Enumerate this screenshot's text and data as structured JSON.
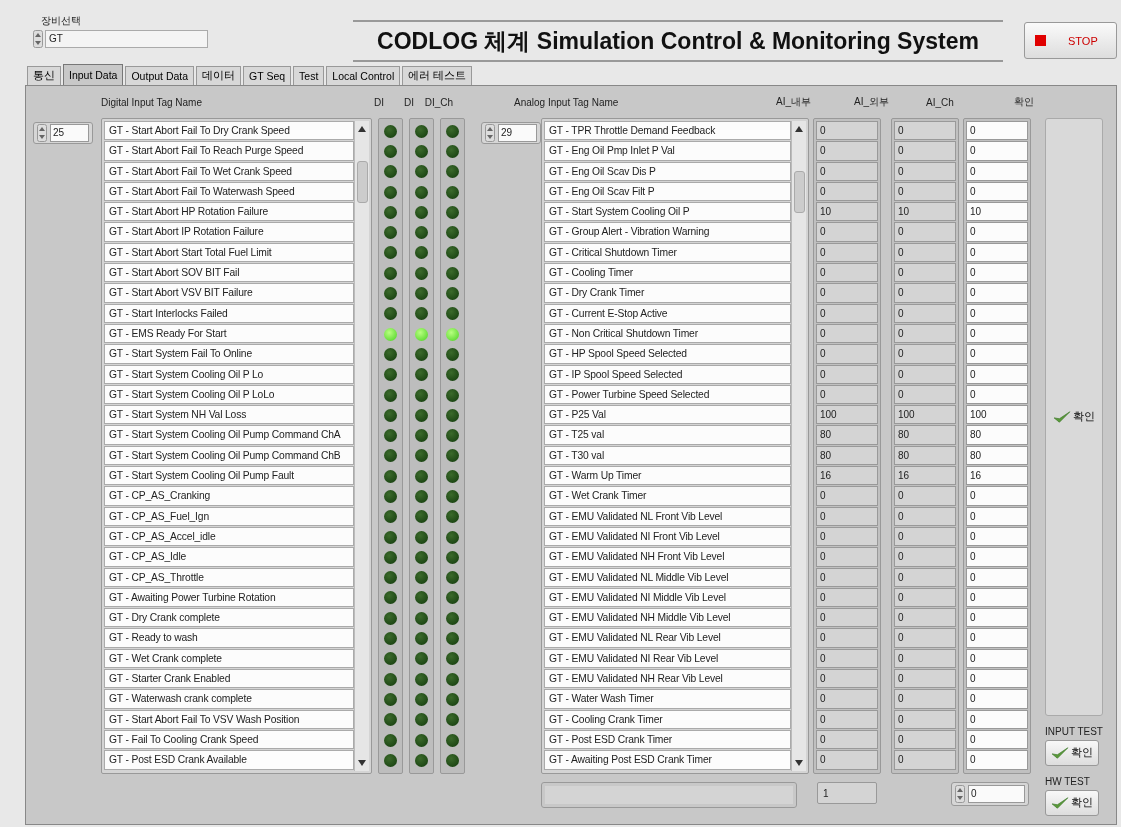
{
  "device_select": {
    "label": "장비선택",
    "value": "GT"
  },
  "title": "CODLOG 체계 Simulation Control & Monitoring System",
  "stop_button": {
    "label": "STOP"
  },
  "tabs": [
    {
      "label": "통신",
      "selected": false
    },
    {
      "label": "Input Data",
      "selected": true
    },
    {
      "label": "Output Data",
      "selected": false
    },
    {
      "label": "데이터",
      "selected": false
    },
    {
      "label": "GT Seq",
      "selected": false
    },
    {
      "label": "Test",
      "selected": false
    },
    {
      "label": "Local Control",
      "selected": false
    },
    {
      "label": "에러 테스트",
      "selected": false
    }
  ],
  "digital": {
    "header": "Digital Input Tag Name",
    "column_headers": [
      "DI",
      "DI",
      "DI_Ch"
    ],
    "index": "25",
    "rows": [
      {
        "name": "GT - Start Abort Fail To Dry Crank Speed",
        "leds": [
          false,
          false,
          false
        ]
      },
      {
        "name": "GT - Start Abort Fail To Reach Purge Speed",
        "leds": [
          false,
          false,
          false
        ]
      },
      {
        "name": "GT - Start Abort Fail To Wet Crank Speed",
        "leds": [
          false,
          false,
          false
        ]
      },
      {
        "name": "GT - Start Abort Fail To Waterwash Speed",
        "leds": [
          false,
          false,
          false
        ]
      },
      {
        "name": "GT - Start Abort HP Rotation Failure",
        "leds": [
          false,
          false,
          false
        ]
      },
      {
        "name": "GT - Start Abort IP Rotation Failure",
        "leds": [
          false,
          false,
          false
        ]
      },
      {
        "name": "GT - Start Abort Start Total Fuel Limit",
        "leds": [
          false,
          false,
          false
        ]
      },
      {
        "name": "GT - Start Abort SOV BIT Fail",
        "leds": [
          false,
          false,
          false
        ]
      },
      {
        "name": "GT - Start Abort VSV BIT Failure",
        "leds": [
          false,
          false,
          false
        ]
      },
      {
        "name": "GT - Start Interlocks Failed",
        "leds": [
          false,
          false,
          false
        ]
      },
      {
        "name": "GT - EMS Ready For Start",
        "leds": [
          true,
          true,
          true
        ]
      },
      {
        "name": "GT - Start System Fail To Online",
        "leds": [
          false,
          false,
          false
        ]
      },
      {
        "name": "GT - Start System Cooling Oil P Lo",
        "leds": [
          false,
          false,
          false
        ]
      },
      {
        "name": "GT - Start System Cooling Oil P LoLo",
        "leds": [
          false,
          false,
          false
        ]
      },
      {
        "name": "GT - Start System NH Val Loss",
        "leds": [
          false,
          false,
          false
        ]
      },
      {
        "name": "GT - Start System Cooling Oil Pump Command ChA",
        "leds": [
          false,
          false,
          false
        ]
      },
      {
        "name": "GT - Start System Cooling Oil Pump Command ChB",
        "leds": [
          false,
          false,
          false
        ]
      },
      {
        "name": "GT - Start System Cooling Oil Pump Fault",
        "leds": [
          false,
          false,
          false
        ]
      },
      {
        "name": "GT - CP_AS_Cranking",
        "leds": [
          false,
          false,
          false
        ]
      },
      {
        "name": "GT - CP_AS_Fuel_Ign",
        "leds": [
          false,
          false,
          false
        ]
      },
      {
        "name": "GT - CP_AS_Accel_idle",
        "leds": [
          false,
          false,
          false
        ]
      },
      {
        "name": "GT - CP_AS_Idle",
        "leds": [
          false,
          false,
          false
        ]
      },
      {
        "name": "GT - CP_AS_Throttle",
        "leds": [
          false,
          false,
          false
        ]
      },
      {
        "name": "GT - Awaiting Power Turbine Rotation",
        "leds": [
          false,
          false,
          false
        ]
      },
      {
        "name": "GT - Dry Crank complete",
        "leds": [
          false,
          false,
          false
        ]
      },
      {
        "name": "GT - Ready to wash",
        "leds": [
          false,
          false,
          false
        ]
      },
      {
        "name": "GT - Wet Crank complete",
        "leds": [
          false,
          false,
          false
        ]
      },
      {
        "name": "GT - Starter Crank Enabled",
        "leds": [
          false,
          false,
          false
        ]
      },
      {
        "name": "GT - Waterwash crank complete",
        "leds": [
          false,
          false,
          false
        ]
      },
      {
        "name": "GT - Start Abort Fail To VSV Wash Position",
        "leds": [
          false,
          false,
          false
        ]
      },
      {
        "name": "GT - Fail To Cooling Crank Speed",
        "leds": [
          false,
          false,
          false
        ]
      },
      {
        "name": "GT - Post ESD Crank Available",
        "leds": [
          false,
          false,
          false
        ]
      }
    ]
  },
  "analog": {
    "header": "Analog Input Tag Name",
    "column_headers": [
      "AI_내부",
      "AI_외부",
      "AI_Ch"
    ],
    "index": "29",
    "rows": [
      {
        "name": "GT - TPR Throttle Demand Feedback",
        "values": [
          "0",
          "0",
          "0"
        ]
      },
      {
        "name": "GT - Eng Oil Pmp Inlet P Val",
        "values": [
          "0",
          "0",
          "0"
        ]
      },
      {
        "name": "GT - Eng Oil Scav Dis P",
        "values": [
          "0",
          "0",
          "0"
        ]
      },
      {
        "name": "GT - Eng Oil Scav Filt P",
        "values": [
          "0",
          "0",
          "0"
        ]
      },
      {
        "name": "GT - Start System Cooling Oil P",
        "values": [
          "10",
          "10",
          "10"
        ]
      },
      {
        "name": "GT - Group Alert - Vibration Warning",
        "values": [
          "0",
          "0",
          "0"
        ]
      },
      {
        "name": "GT - Critical Shutdown Timer",
        "values": [
          "0",
          "0",
          "0"
        ]
      },
      {
        "name": "GT - Cooling Timer",
        "values": [
          "0",
          "0",
          "0"
        ]
      },
      {
        "name": "GT - Dry Crank Timer",
        "values": [
          "0",
          "0",
          "0"
        ]
      },
      {
        "name": "GT - Current E-Stop Active",
        "values": [
          "0",
          "0",
          "0"
        ]
      },
      {
        "name": "GT - Non Critical Shutdown Timer",
        "values": [
          "0",
          "0",
          "0"
        ]
      },
      {
        "name": "GT - HP Spool Speed Selected",
        "values": [
          "0",
          "0",
          "0"
        ]
      },
      {
        "name": "GT - IP Spool Speed Selected",
        "values": [
          "0",
          "0",
          "0"
        ]
      },
      {
        "name": "GT - Power Turbine Speed Selected",
        "values": [
          "0",
          "0",
          "0"
        ]
      },
      {
        "name": "GT - P25 Val",
        "values": [
          "100",
          "100",
          "100"
        ]
      },
      {
        "name": "GT - T25 val",
        "values": [
          "80",
          "80",
          "80"
        ]
      },
      {
        "name": "GT - T30 val",
        "values": [
          "80",
          "80",
          "80"
        ]
      },
      {
        "name": "GT - Warm Up Timer",
        "values": [
          "16",
          "16",
          "16"
        ]
      },
      {
        "name": "GT - Wet Crank Timer",
        "values": [
          "0",
          "0",
          "0"
        ]
      },
      {
        "name": "GT - EMU Validated NL Front Vib Level",
        "values": [
          "0",
          "0",
          "0"
        ]
      },
      {
        "name": "GT - EMU Validated NI Front Vib Level",
        "values": [
          "0",
          "0",
          "0"
        ]
      },
      {
        "name": "GT - EMU Validated NH Front Vib Level",
        "values": [
          "0",
          "0",
          "0"
        ]
      },
      {
        "name": "GT - EMU Validated NL Middle Vib Level",
        "values": [
          "0",
          "0",
          "0"
        ]
      },
      {
        "name": "GT - EMU Validated NI Middle Vib Level",
        "values": [
          "0",
          "0",
          "0"
        ]
      },
      {
        "name": "GT - EMU Validated NH Middle Vib Level",
        "values": [
          "0",
          "0",
          "0"
        ]
      },
      {
        "name": "GT - EMU Validated NL Rear Vib Level",
        "values": [
          "0",
          "0",
          "0"
        ]
      },
      {
        "name": "GT - EMU Validated NI Rear Vib Level",
        "values": [
          "0",
          "0",
          "0"
        ]
      },
      {
        "name": "GT - EMU Validated NH Rear Vib Level",
        "values": [
          "0",
          "0",
          "0"
        ]
      },
      {
        "name": "GT - Water Wash Timer",
        "values": [
          "0",
          "0",
          "0"
        ]
      },
      {
        "name": "GT - Cooling Crank Timer",
        "values": [
          "0",
          "0",
          "0"
        ]
      },
      {
        "name": "GT - Post ESD Crank Timer",
        "values": [
          "0",
          "0",
          "0"
        ]
      },
      {
        "name": "GT - Awaiting Post ESD Crank Timer",
        "values": [
          "0",
          "0",
          "0"
        ]
      }
    ],
    "status_value": "1",
    "count": "0"
  },
  "confirm": {
    "header": "확인",
    "button": "확인"
  },
  "input_test": {
    "label": "INPUT TEST",
    "button": "확인"
  },
  "hw_test": {
    "label": "HW TEST",
    "button": "확인"
  }
}
